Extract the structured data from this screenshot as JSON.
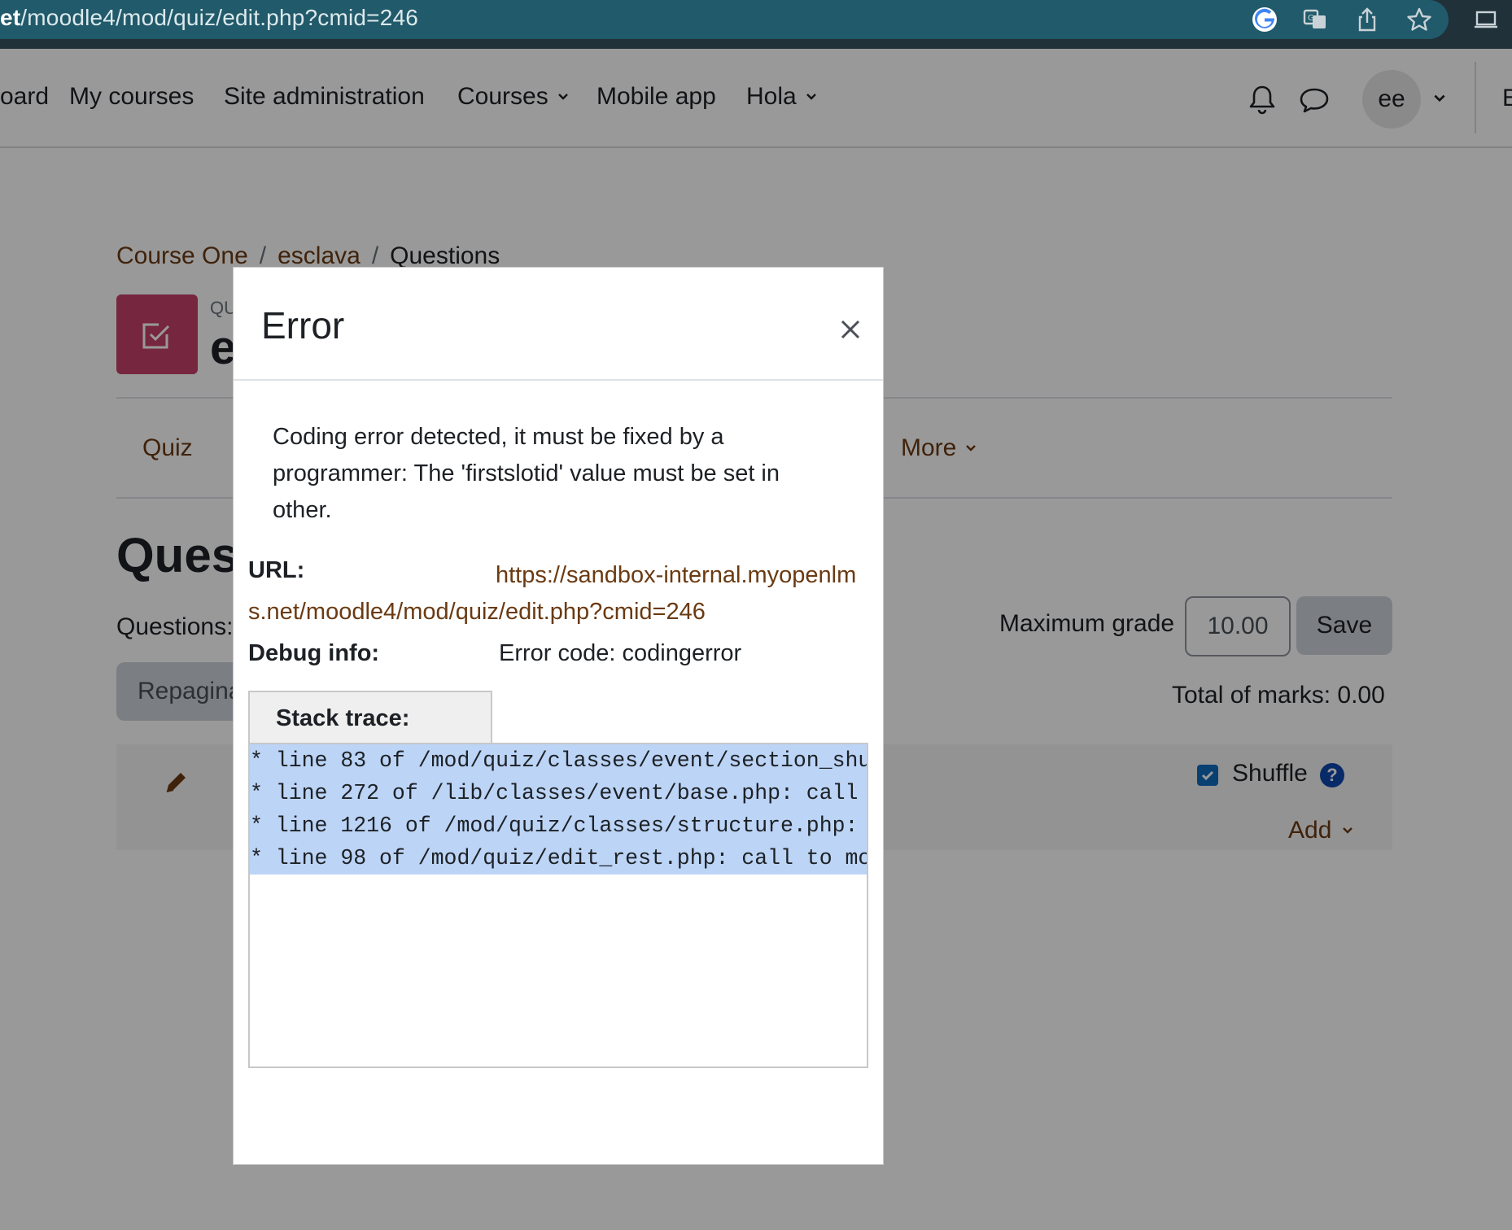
{
  "browser": {
    "url_host_fragment": "et",
    "url_path": "/moodle4/mod/quiz/edit.php?cmid=246",
    "icons": [
      "google-icon",
      "translate-icon",
      "share-icon",
      "star-icon",
      "laptop-icon"
    ]
  },
  "nav": {
    "items": [
      {
        "label": "oard"
      },
      {
        "label": "My courses"
      },
      {
        "label": "Site administration"
      },
      {
        "label": "Courses",
        "has_menu": true
      },
      {
        "label": "Mobile app"
      },
      {
        "label": "Hola",
        "has_menu": true
      }
    ],
    "avatar_initials": "ee",
    "edit_label_fragment": "E"
  },
  "breadcrumb": {
    "items": [
      "Course One",
      "esclava",
      "Questions"
    ]
  },
  "activity": {
    "type_label_fragment": "QU",
    "title_fragment": "e",
    "icon_color": "#c6406a"
  },
  "tabs": {
    "quiz_label": "Quiz",
    "more_label": "More"
  },
  "main": {
    "heading_fragment": "Ques",
    "questions_label_fragment": "Questions:",
    "max_grade_label": "Maximum grade",
    "max_grade_value": "10.00",
    "save_label": "Save",
    "repaginate_fragment": "Repagina",
    "total_marks": "Total of marks: 0.00",
    "shuffle_label": "Shuffle",
    "shuffle_checked": true,
    "help_glyph": "?",
    "add_label": "Add"
  },
  "dialog": {
    "title": "Error",
    "message": "Coding error detected, it must be fixed by a programmer: The 'firstslotid' value must be set in other.",
    "url_label": "URL:",
    "url_value": "https://sandbox-internal.myopenlms.net/moodle4/mod/quiz/edit.php?cmid=246",
    "debug_label": "Debug info:",
    "debug_value": "Error code: codingerror",
    "stack_label": "Stack trace:",
    "stack_lines": [
      "* line 83 of /mod/quiz/classes/event/section_shu",
      "* line 272 of /lib/classes/event/base.php: call",
      "* line 1216 of /mod/quiz/classes/structure.php:",
      "* line 98 of /mod/quiz/edit_rest.php: call to mo"
    ]
  },
  "colors": {
    "link": "#6b3a12",
    "browser_bar": "#21313a",
    "address_pill": "#215a6a",
    "stack_highlight": "#bcd4f6",
    "checkbox": "#0f6cbf"
  }
}
